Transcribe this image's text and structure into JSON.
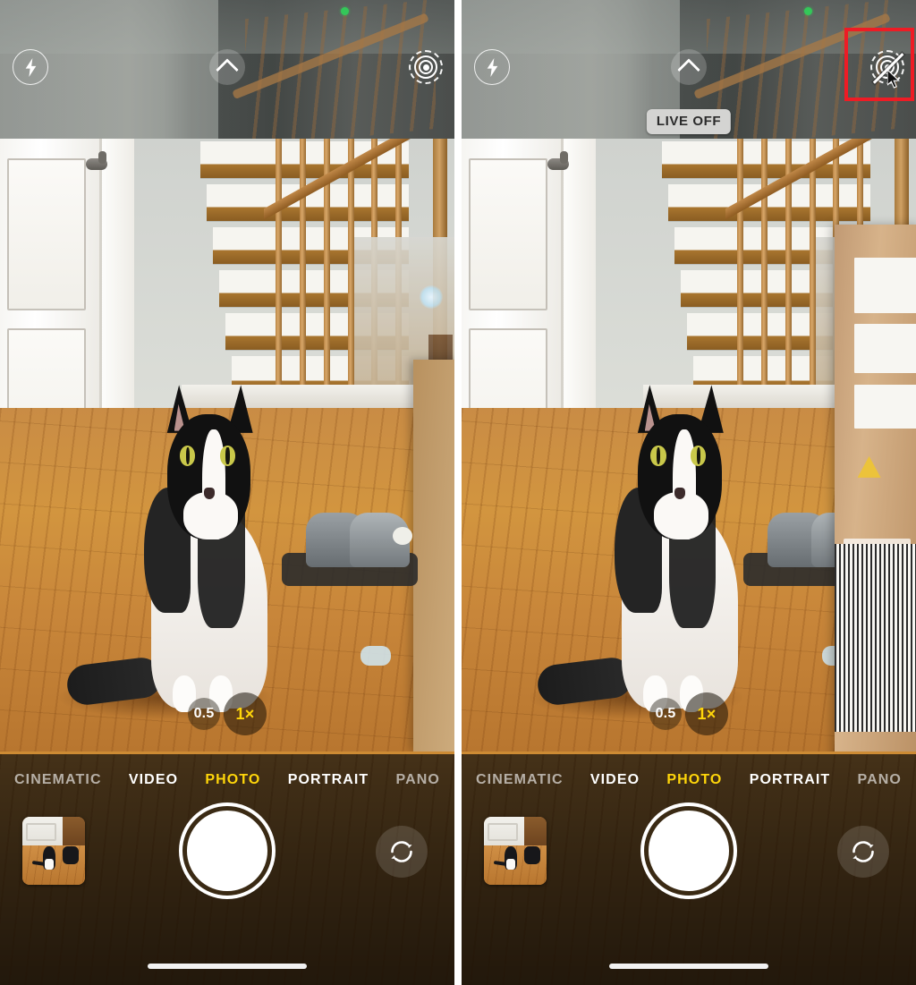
{
  "screenshot": {
    "description": "Side-by-side iPhone Camera app screenshots showing Live Photo being turned off",
    "panel_count": 2
  },
  "panels": [
    {
      "id": "before",
      "top_controls": {
        "flash": {
          "label": "Flash",
          "icon": "flash-bolt-icon",
          "state": "auto"
        },
        "more": {
          "label": "More controls",
          "icon": "chevron-up-icon"
        },
        "live_photo": {
          "label": "Live Photo",
          "icon": "live-photo-on-icon",
          "state": "on"
        }
      },
      "privacy_indicator": {
        "color": "#34c759",
        "label": "Camera in use"
      },
      "badge": {
        "visible": false,
        "text": ""
      },
      "highlight": {
        "visible": false,
        "color": "#ee1c25"
      },
      "cursor": {
        "visible": false
      },
      "zoom": {
        "options": [
          {
            "label": "0.5",
            "active": false
          },
          {
            "label": "1×",
            "active": true
          }
        ]
      },
      "modes": [
        {
          "label": "CINEMATIC",
          "active": false,
          "dim": true
        },
        {
          "label": "VIDEO",
          "active": false,
          "dim": false
        },
        {
          "label": "PHOTO",
          "active": true,
          "dim": false
        },
        {
          "label": "PORTRAIT",
          "active": false,
          "dim": false
        },
        {
          "label": "PANO",
          "active": false,
          "dim": true
        }
      ],
      "bottom_controls": {
        "thumbnail": {
          "label": "Last photo",
          "alt": "Tuxedo cat on hardwood floor"
        },
        "shutter": {
          "label": "Take photo"
        },
        "flip": {
          "label": "Switch camera",
          "icon": "camera-flip-icon"
        }
      }
    },
    {
      "id": "after",
      "top_controls": {
        "flash": {
          "label": "Flash",
          "icon": "flash-bolt-icon",
          "state": "auto"
        },
        "more": {
          "label": "More controls",
          "icon": "chevron-up-icon"
        },
        "live_photo": {
          "label": "Live Photo",
          "icon": "live-photo-off-icon",
          "state": "off"
        }
      },
      "privacy_indicator": {
        "color": "#34c759",
        "label": "Camera in use"
      },
      "badge": {
        "visible": true,
        "text": "LIVE OFF"
      },
      "highlight": {
        "visible": true,
        "color": "#ee1c25"
      },
      "cursor": {
        "visible": true
      },
      "zoom": {
        "options": [
          {
            "label": "0.5",
            "active": false
          },
          {
            "label": "1×",
            "active": true
          }
        ]
      },
      "modes": [
        {
          "label": "CINEMATIC",
          "active": false,
          "dim": true
        },
        {
          "label": "VIDEO",
          "active": false,
          "dim": false
        },
        {
          "label": "PHOTO",
          "active": true,
          "dim": false
        },
        {
          "label": "PORTRAIT",
          "active": false,
          "dim": false
        },
        {
          "label": "PANO",
          "active": false,
          "dim": true
        }
      ],
      "bottom_controls": {
        "thumbnail": {
          "label": "Last photo",
          "alt": "Tuxedo cat on hardwood floor"
        },
        "shutter": {
          "label": "Take photo"
        },
        "flip": {
          "label": "Switch camera",
          "icon": "camera-flip-icon"
        }
      }
    }
  ],
  "colors": {
    "accent_yellow": "#ffd60a",
    "highlight_red": "#ee1c25",
    "privacy_green": "#34c759",
    "badge_bg": "#d4d4d2",
    "badge_text": "#2b2b2b"
  }
}
